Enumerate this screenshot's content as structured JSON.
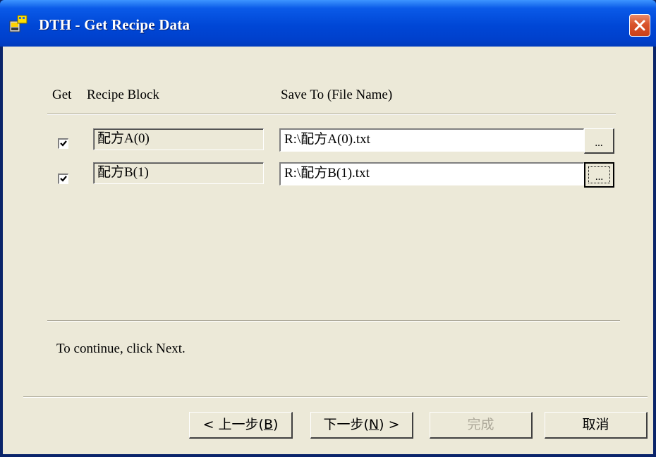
{
  "window": {
    "title": "DTH - Get Recipe Data",
    "close_label": "×"
  },
  "header": {
    "col_get": "Get",
    "col_block": "Recipe Block",
    "col_save": "Save To (File Name)"
  },
  "rows": [
    {
      "checked": true,
      "block": "配方A(0)",
      "file": "R:\\配方A(0).txt",
      "browse_label": "..."
    },
    {
      "checked": true,
      "block": "配方B(1)",
      "file": "R:\\配方B(1).txt",
      "browse_label": "..."
    }
  ],
  "hint": "To continue, click Next.",
  "buttons": {
    "back_pre": "< 上一步(",
    "back_key": "B",
    "back_post": ")",
    "next_pre": "下一步(",
    "next_key": "N",
    "next_post": ") >",
    "finish": "完成",
    "cancel": "取消"
  },
  "colors": {
    "title_bar": "#0047d6",
    "face": "#ece9d8",
    "close": "#d9532b"
  }
}
